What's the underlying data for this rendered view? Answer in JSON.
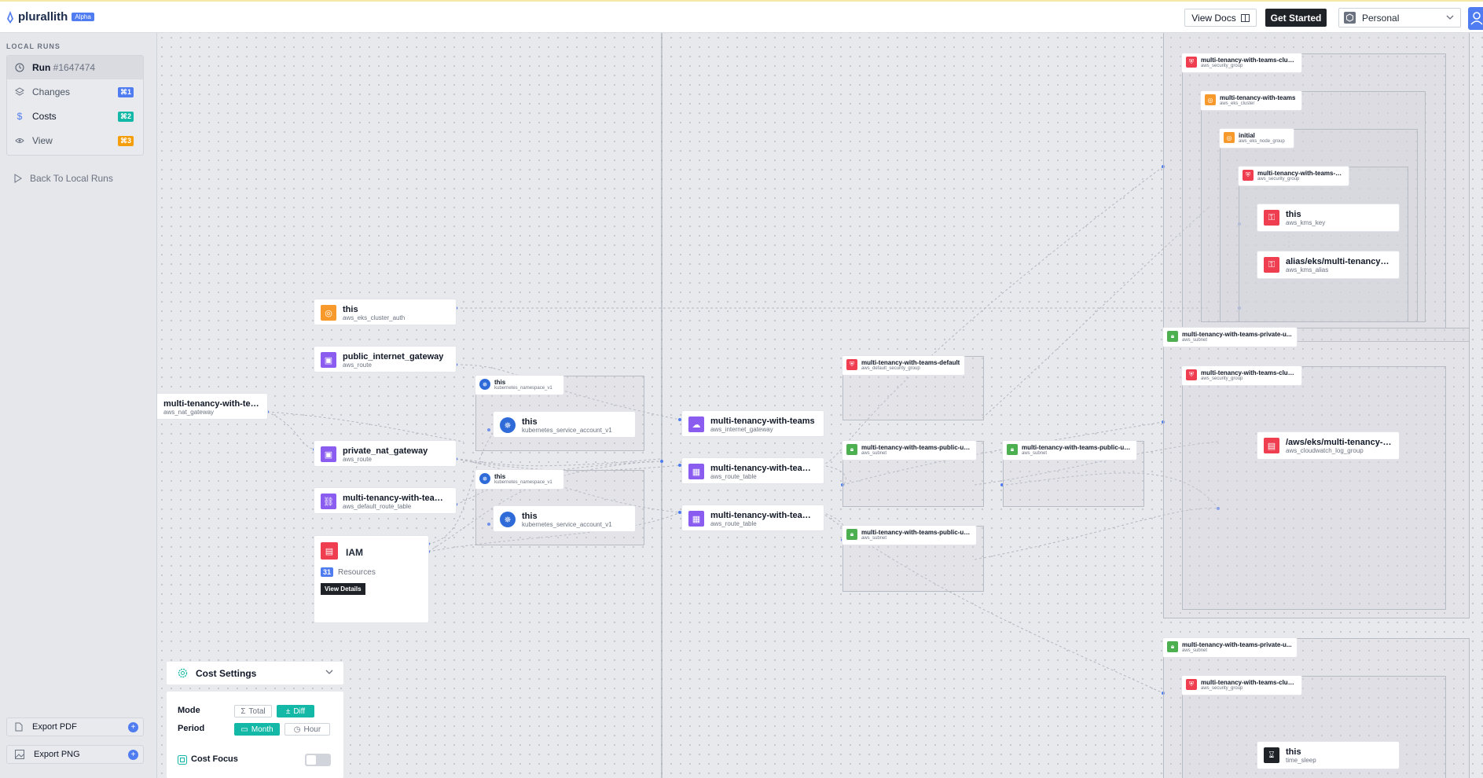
{
  "header": {
    "brand_name": "plurallith",
    "brand_badge": "Alpha",
    "docs_label": "View Docs",
    "start_label": "Get Started",
    "workspace": "Personal"
  },
  "sidebar": {
    "heading": "LOCAL RUNS",
    "items": [
      {
        "label": "Run",
        "id": "#1647474",
        "icon": "history-icon"
      },
      {
        "label": "Changes",
        "shortcut": "⌘1",
        "icon": "layers-icon",
        "color": "#4f7cf0"
      },
      {
        "label": "Costs",
        "shortcut": "⌘2",
        "icon": "dollar-icon",
        "color": "#14b8a6"
      },
      {
        "label": "View",
        "shortcut": "⌘3",
        "icon": "eye-icon",
        "color": "#f59e0b"
      }
    ],
    "back_label": "Back To Local Runs",
    "export_pdf": "Export PDF",
    "export_png": "Export PNG"
  },
  "nodes": {
    "eks_auth": {
      "title": "this",
      "type": "aws_eks_cluster_auth"
    },
    "public_route": {
      "title": "public_internet_gateway",
      "type": "aws_route"
    },
    "nat_gateway": {
      "title": "multi-tenancy-with-teams-...",
      "type": "aws_nat_gateway"
    },
    "private_route": {
      "title": "private_nat_gateway",
      "type": "aws_route"
    },
    "default_rt": {
      "title": "multi-tenancy-with-teams-...",
      "type": "aws_default_route_table"
    },
    "ns1": {
      "title": "this",
      "type": "kubernetes_namespace_v1"
    },
    "sa1": {
      "title": "this",
      "type": "kubernetes_service_account_v1"
    },
    "ns2": {
      "title": "this",
      "type": "kubernetes_namespace_v1"
    },
    "sa2": {
      "title": "this",
      "type": "kubernetes_service_account_v1"
    },
    "igw": {
      "title": "multi-tenancy-with-teams",
      "type": "aws_internet_gateway"
    },
    "rt1": {
      "title": "multi-tenancy-with-teams-...",
      "type": "aws_route_table"
    },
    "rt2": {
      "title": "multi-tenancy-with-teams-...",
      "type": "aws_route_table"
    },
    "default_sg": {
      "title": "multi-tenancy-with-teams-default",
      "type": "aws_default_security_group"
    },
    "pub_subnet1": {
      "title": "multi-tenancy-with-teams-public-us...",
      "type": "aws_subnet"
    },
    "pub_subnet2": {
      "title": "multi-tenancy-with-teams-public-us...",
      "type": "aws_subnet"
    },
    "pub_subnet3": {
      "title": "multi-tenancy-with-teams-public-us...",
      "type": "aws_subnet"
    },
    "cluster_sg1": {
      "title": "multi-tenancy-with-teams-cluster",
      "type": "aws_security_group"
    },
    "eks_cluster": {
      "title": "multi-tenancy-with-teams",
      "type": "aws_eks_cluster"
    },
    "node_group": {
      "title": "initial",
      "type": "aws_eks_node_group"
    },
    "node_sg": {
      "title": "multi-tenancy-with-teams-node",
      "type": "aws_security_group"
    },
    "kms_key": {
      "title": "this",
      "type": "aws_kms_key"
    },
    "kms_alias": {
      "title": "alias/eks/multi-tenancy-wit...",
      "type": "aws_kms_alias"
    },
    "priv_subnet1": {
      "title": "multi-tenancy-with-teams-private-u...",
      "type": "aws_subnet"
    },
    "cluster_sg2": {
      "title": "multi-tenancy-with-teams-cluster",
      "type": "aws_security_group"
    },
    "log_group": {
      "title": "/aws/eks/multi-tenancy-wit...",
      "type": "aws_cloudwatch_log_group"
    },
    "priv_subnet2": {
      "title": "multi-tenancy-with-teams-private-u...",
      "type": "aws_subnet"
    },
    "cluster_sg3": {
      "title": "multi-tenancy-with-teams-cluster",
      "type": "aws_security_group"
    },
    "time_sleep": {
      "title": "this",
      "type": "time_sleep"
    }
  },
  "iam": {
    "title": "IAM",
    "count": "31",
    "count_label": "Resources",
    "button": "View Details"
  },
  "cost_settings": {
    "title": "Cost Settings",
    "mode_label": "Mode",
    "mode_total": "Total",
    "mode_diff": "Diff",
    "period_label": "Period",
    "period_month": "Month",
    "period_hour": "Hour",
    "focus_label": "Cost Focus",
    "focus_on": false
  },
  "colors": {
    "accent": "#4f7cf0",
    "teal": "#14b8a6",
    "orange": "#f79a2b",
    "purple": "#8a5cf0",
    "red": "#ee3e4f",
    "green": "#4caf50"
  }
}
